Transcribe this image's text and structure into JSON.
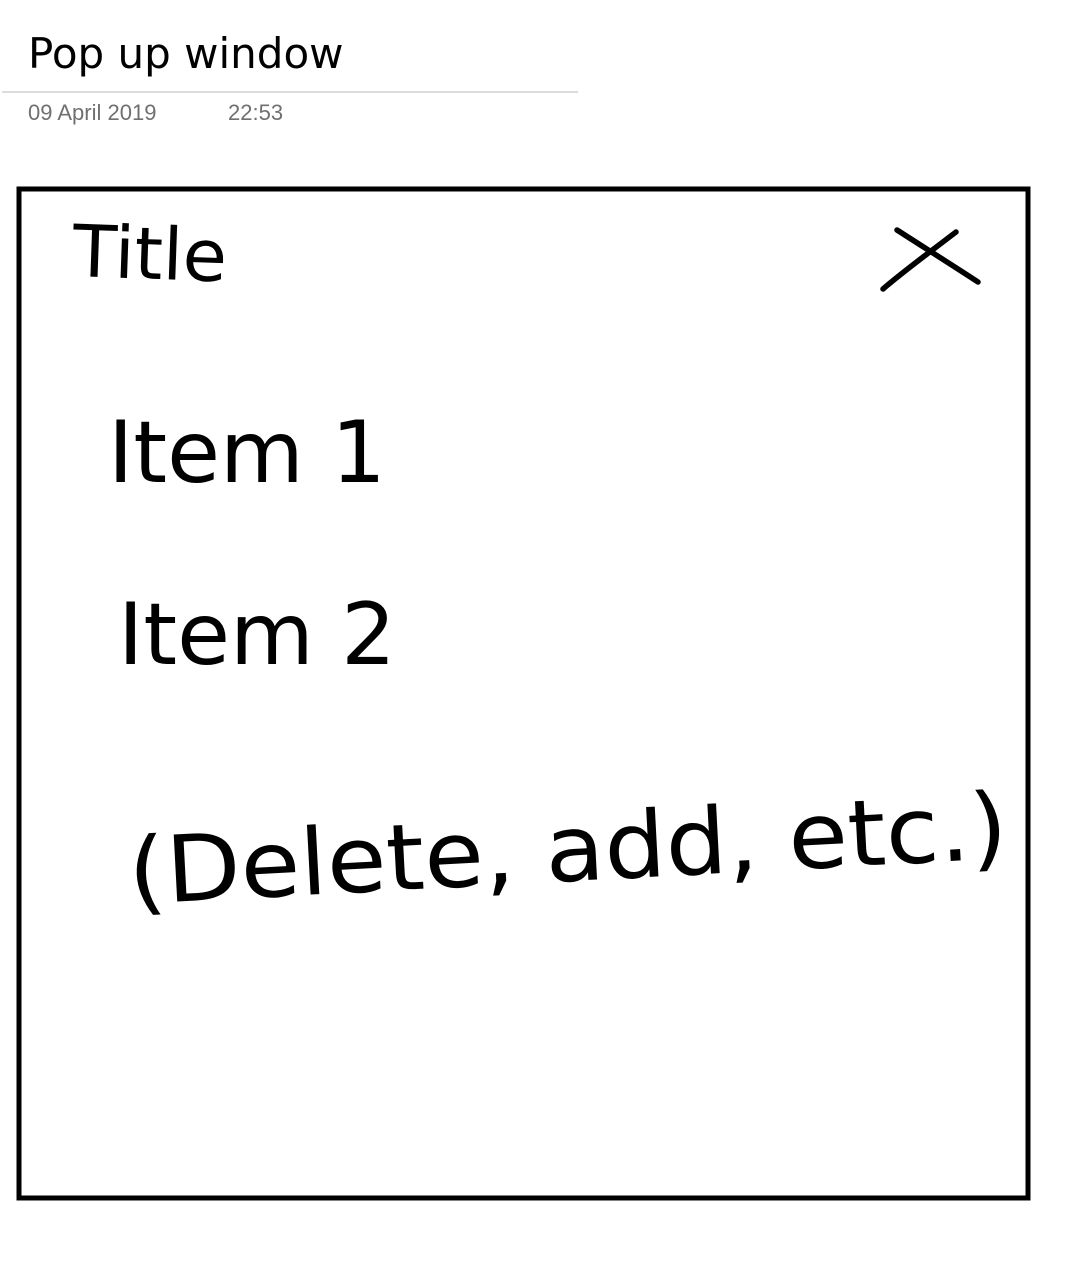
{
  "page": {
    "title": "Pop up window",
    "date": "09 April 2019",
    "time": "22:53"
  },
  "sketch": {
    "popup": {
      "title": "Title",
      "close_icon": "close-icon",
      "items": [
        {
          "label": "Item 1"
        },
        {
          "label": "Item 2"
        }
      ],
      "note": "(Delete, add, etc.)"
    },
    "colors": {
      "ink": "#000000",
      "meta_text": "#707070",
      "rule": "#dcdcdc",
      "background": "#ffffff"
    }
  }
}
